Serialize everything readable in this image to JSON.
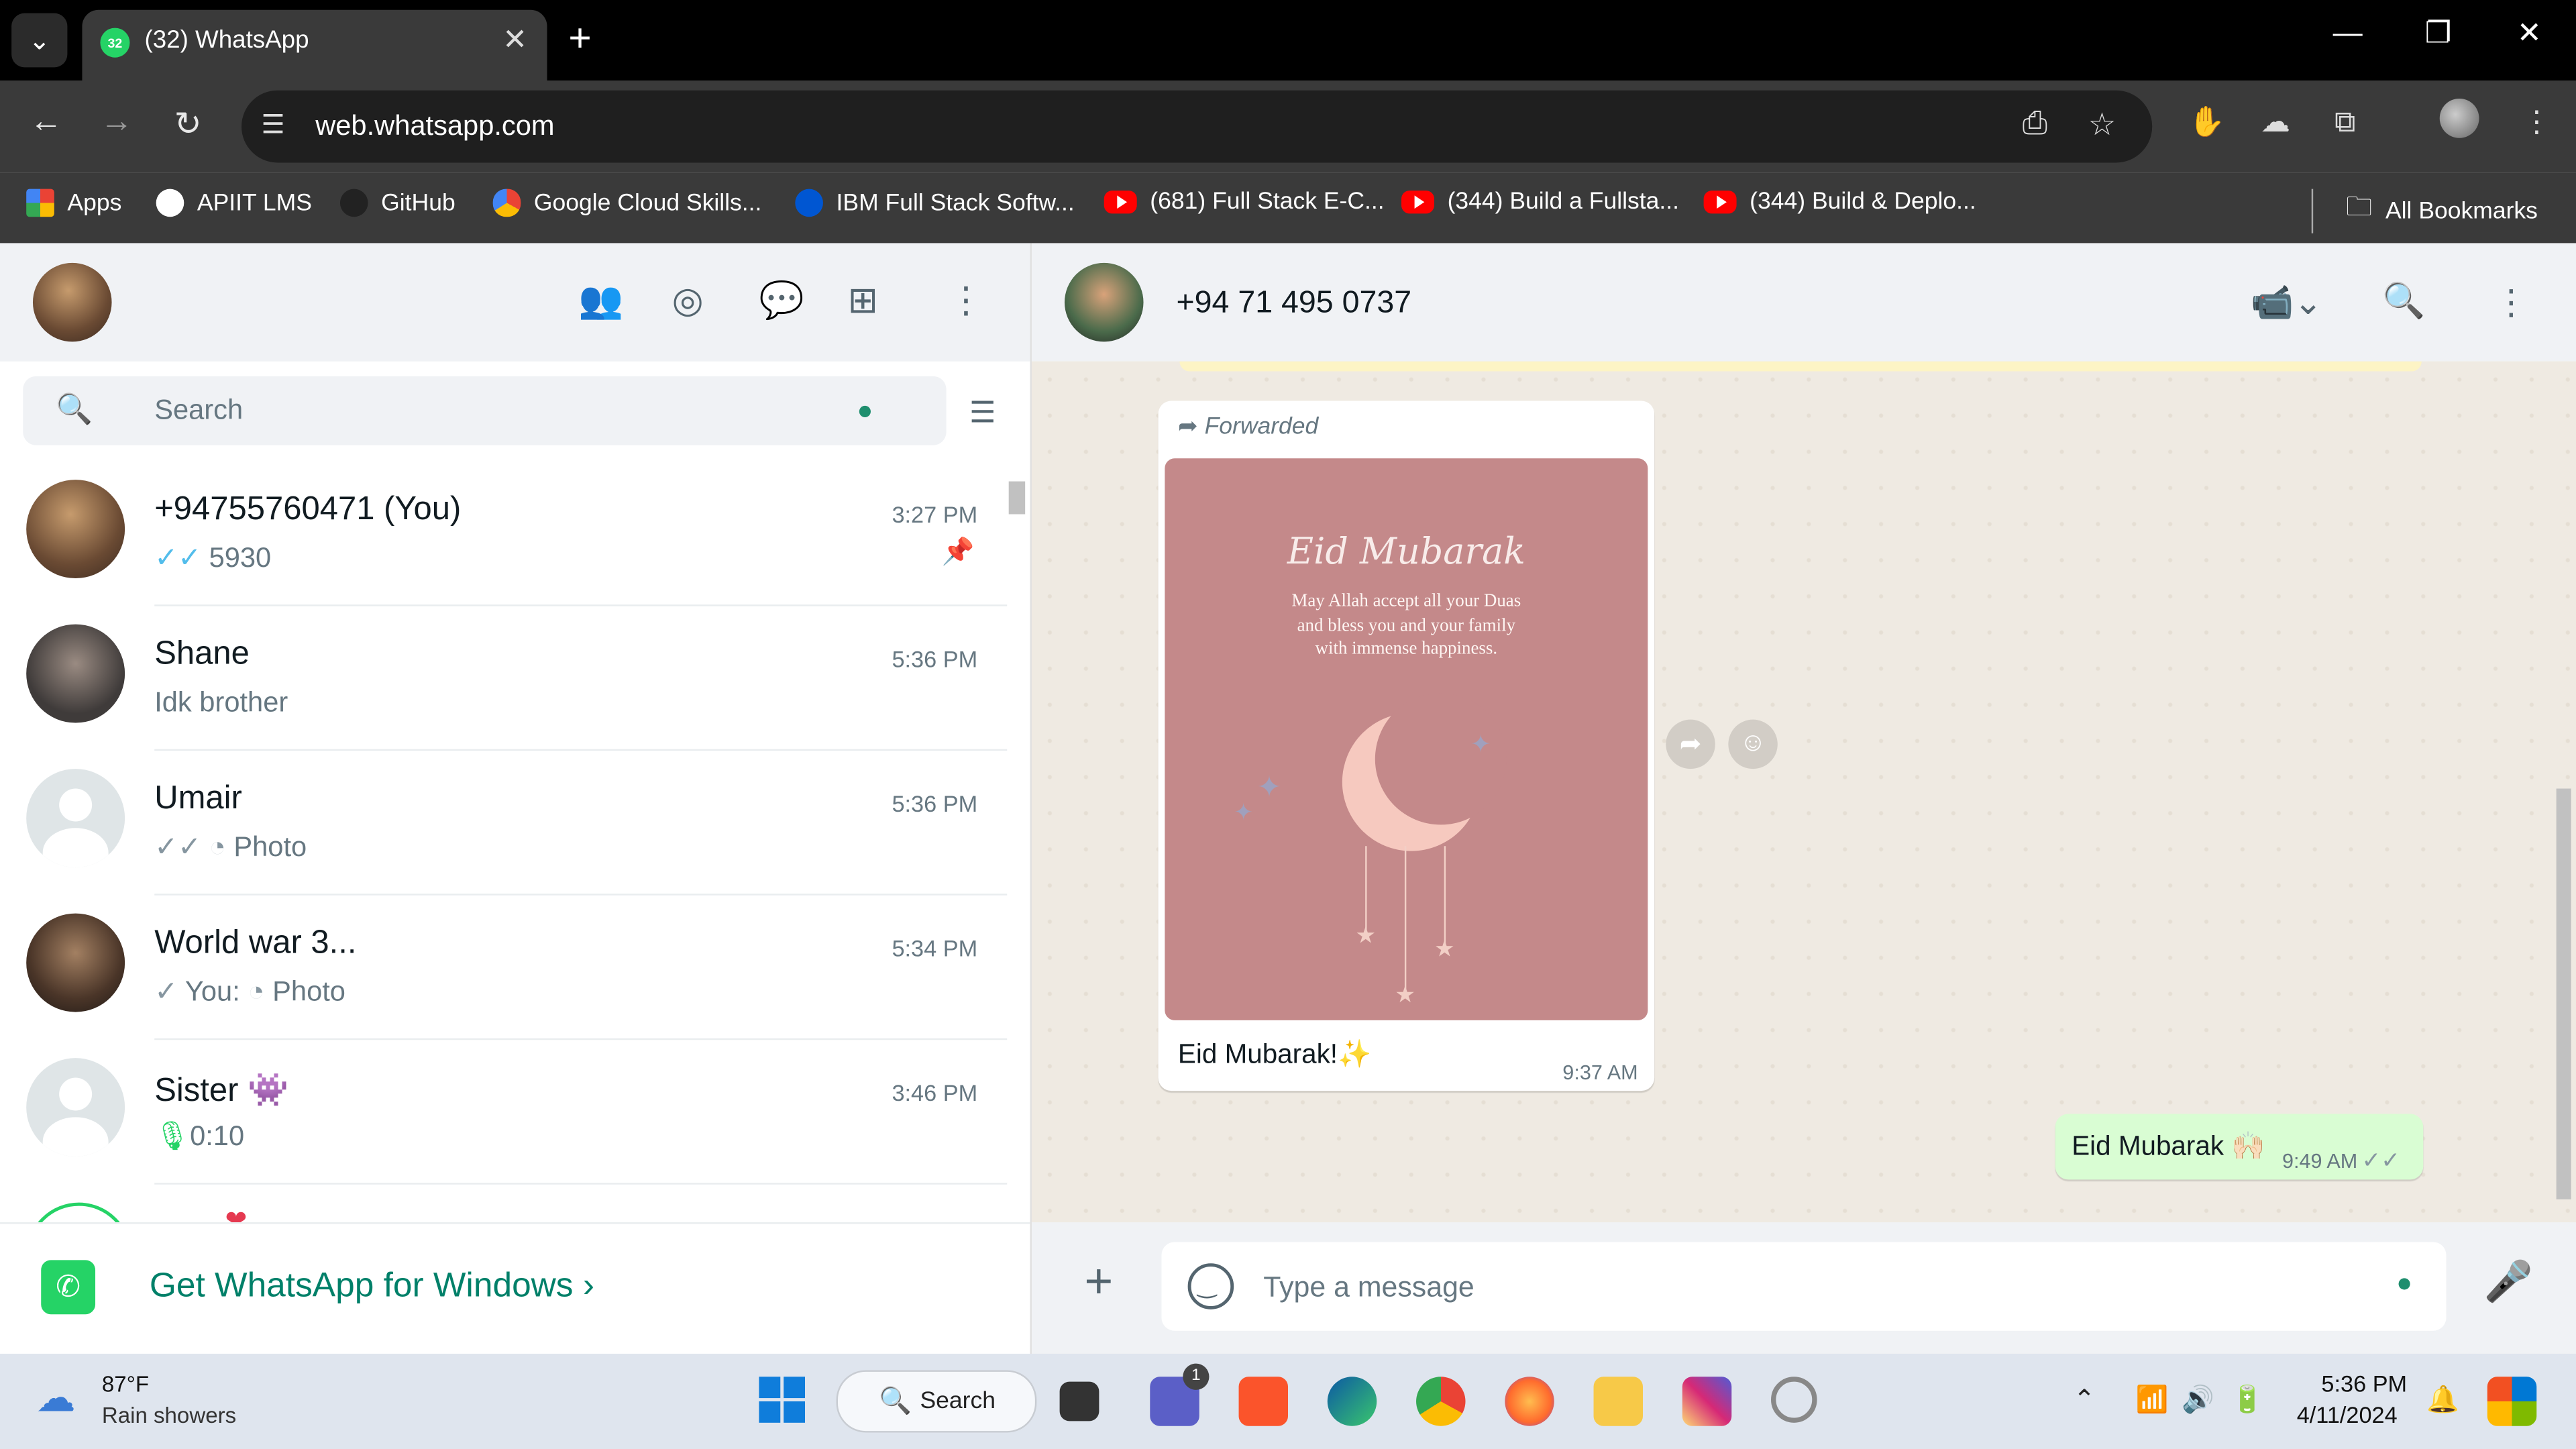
{
  "browser": {
    "tab_title": "(32) WhatsApp",
    "tab_badge": "32",
    "url": "web.whatsapp.com",
    "bookmarks": [
      "Apps",
      "APIIT LMS",
      "GitHub",
      "Google Cloud Skills...",
      "IBM Full Stack Softw...",
      "(681) Full Stack E-C...",
      "(344) Build a Fullsta...",
      "(344) Build & Deplo..."
    ],
    "all_bookmarks": "All Bookmarks"
  },
  "sidebar": {
    "search_placeholder": "Search",
    "chats": [
      {
        "name": "+94755760471 (You)",
        "preview": "5930",
        "time": "3:27 PM",
        "status": "read",
        "pinned": true
      },
      {
        "name": "Shane",
        "preview": "Idk brother",
        "time": "5:36 PM"
      },
      {
        "name": "Umair",
        "preview": "Photo",
        "time": "5:36 PM",
        "status": "delivered"
      },
      {
        "name": "World war 3...",
        "prefix": "You:",
        "preview": "Photo",
        "time": "5:34 PM",
        "status": "sent"
      },
      {
        "name": "Sister",
        "preview": "0:10",
        "time": "3:46 PM",
        "status": "voice"
      }
    ],
    "get_app": "Get WhatsApp for Windows"
  },
  "conversation": {
    "contact": "+94 71 495 0737",
    "messages": [
      {
        "direction": "in",
        "forwarded_label": "Forwarded",
        "image_title": "Eid Mubarak",
        "image_text": "May Allah accept all your Duas and bless you and your family with immense happiness.",
        "caption": "Eid Mubarak!✨",
        "time": "9:37 AM"
      },
      {
        "direction": "out",
        "text": "Eid Mubarak 🙌🏻",
        "time": "9:49 AM",
        "status": "delivered"
      }
    ],
    "composer_placeholder": "Type a message"
  },
  "taskbar": {
    "temperature": "87°F",
    "weather": "Rain showers",
    "search_label": "Search",
    "time": "5:36 PM",
    "date": "4/11/2024",
    "teams_badge": "1"
  },
  "colors": {
    "accent": "#008069",
    "outgoing_bubble": "#d9fdd3",
    "chat_bg": "#efeae2",
    "read_tick": "#53bdeb"
  }
}
